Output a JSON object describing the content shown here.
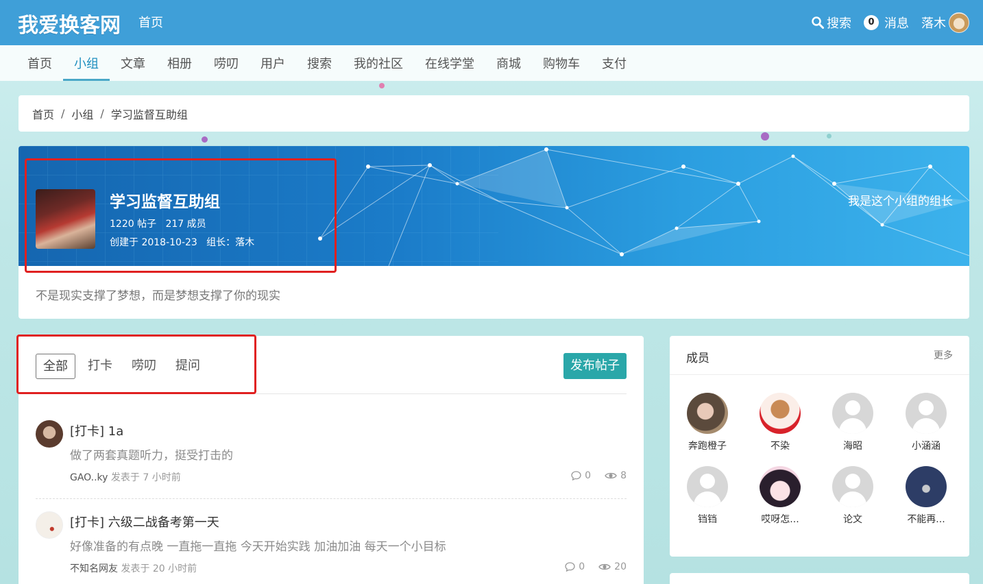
{
  "site": {
    "logo_text": "我爱换客网",
    "home_label": "首页",
    "search_label": "搜索",
    "messages_count": "0",
    "messages_label": "消息",
    "username": "落木"
  },
  "nav": {
    "items": [
      "首页",
      "小组",
      "文章",
      "相册",
      "唠叨",
      "用户",
      "搜索",
      "我的社区",
      "在线学堂",
      "商城",
      "购物车",
      "支付"
    ],
    "active_index": 1
  },
  "breadcrumb": [
    "首页",
    "小组",
    "学习监督互助组"
  ],
  "group": {
    "title": "学习监督互助组",
    "posts_count": "1220 帖子",
    "members_count": "217 成员",
    "created": "创建于 2018-10-23",
    "owner": "组长：落木",
    "owner_link": "我是这个小组的组长",
    "description": "不是现实支撑了梦想，而是梦想支撑了你的现实"
  },
  "tabs": [
    "全部",
    "打卡",
    "唠叨",
    "提问"
  ],
  "publish_label": "发布帖子",
  "posts": [
    {
      "title": "[打卡] 1a",
      "excerpt": "做了两套真题听力，挺受打击的",
      "author": "GAO..ky",
      "time": "发表于 7 小时前",
      "comments": "0",
      "views": "8"
    },
    {
      "title": "[打卡] 六级二战备考第一天",
      "excerpt": "好像准备的有点晚 一直拖一直拖 今天开始实践 加油加油 每天一个小目标",
      "author": "不知名网友",
      "time": "发表于 20 小时前",
      "comments": "0",
      "views": "20"
    }
  ],
  "members": {
    "title": "成员",
    "more": "更多",
    "list": [
      "奔跑橙子",
      "不染",
      "海昭",
      "小涵涵",
      "铛铛",
      "哎呀怎...",
      "论文",
      "不能再..."
    ]
  },
  "colors": {
    "topbar": "#3f9fd8",
    "accent": "#2aa7a9",
    "highlight": "#e02020"
  }
}
